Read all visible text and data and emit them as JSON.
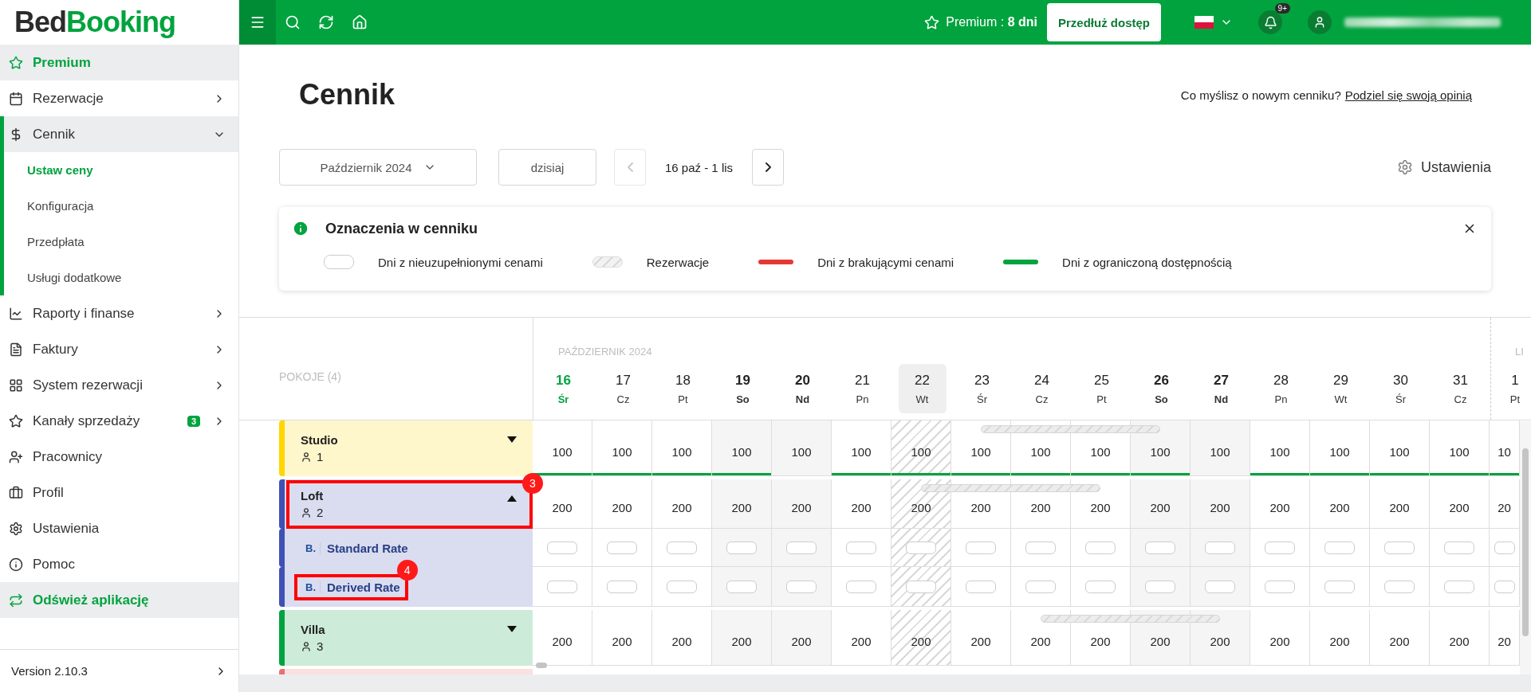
{
  "brand": {
    "part_1": "Bed",
    "part_2": "Booking"
  },
  "sidebar": {
    "items": [
      {
        "label": "Premium",
        "kind": "accent"
      },
      {
        "label": "Rezerwacje",
        "kind": "link",
        "expanded": false
      },
      {
        "label": "Cennik",
        "kind": "link",
        "expanded": true,
        "children": [
          {
            "label": "Ustaw ceny",
            "selected": true
          },
          {
            "label": "Konfiguracja",
            "selected": false
          },
          {
            "label": "Przedpłata",
            "selected": false
          },
          {
            "label": "Usługi dodatkowe",
            "selected": false
          }
        ]
      },
      {
        "label": "Raporty i finanse",
        "kind": "link",
        "expanded": false
      },
      {
        "label": "Faktury",
        "kind": "link",
        "expanded": false
      },
      {
        "label": "System rezerwacji",
        "kind": "link",
        "expanded": false
      },
      {
        "label": "Kanały sprzedaży",
        "kind": "link",
        "expanded": false,
        "badge": "3"
      },
      {
        "label": "Pracownicy",
        "kind": "link"
      },
      {
        "label": "Profil",
        "kind": "link"
      },
      {
        "label": "Ustawienia",
        "kind": "link"
      },
      {
        "label": "Pomoc",
        "kind": "link"
      },
      {
        "label": "Odśwież aplikację",
        "kind": "accent"
      }
    ],
    "version": "Version 2.10.3"
  },
  "topbar": {
    "premium": "Premium : **8 dni**",
    "extend_button": "Przedłuż dostęp",
    "notifications_badge": "9+"
  },
  "page": {
    "title": "Cennik",
    "feedback_question": "Co myślisz o nowym cenniku?",
    "feedback_link": "Podziel się swoją opinią"
  },
  "toolbar": {
    "month_select": "Październik 2024",
    "today_button": "dzisiaj",
    "range": "16 paź - 1 lis",
    "prev_disabled": true,
    "next_disabled": false,
    "settings": "Ustawienia"
  },
  "legend": {
    "title": "Oznaczenia w cenniku",
    "items": [
      {
        "kind": "empty",
        "label": "Dni z nieuzupełnionymi cenami"
      },
      {
        "kind": "hatched",
        "label": "Rezerwacje"
      },
      {
        "kind": "missing",
        "label": "Dni z brakującymi cenami"
      },
      {
        "kind": "limited",
        "label": "Dni z ograniczoną dostępnością"
      }
    ]
  },
  "grid": {
    "rooms_header": "POKOJE (4)",
    "months": [
      {
        "label": "PAŹDZIERNIK 2024",
        "days": [
          {
            "day": "16",
            "weekday": "Śr",
            "today": true,
            "weekend": false,
            "highlighted": false,
            "hatched": false
          },
          {
            "day": "17",
            "weekday": "Cz",
            "today": false,
            "weekend": false,
            "highlighted": false,
            "hatched": false
          },
          {
            "day": "18",
            "weekday": "Pt",
            "today": false,
            "weekend": false,
            "highlighted": false,
            "hatched": false
          },
          {
            "day": "19",
            "weekday": "So",
            "today": false,
            "weekend": true,
            "highlighted": false,
            "hatched": false
          },
          {
            "day": "20",
            "weekday": "Nd",
            "today": false,
            "weekend": true,
            "highlighted": false,
            "hatched": false
          },
          {
            "day": "21",
            "weekday": "Pn",
            "today": false,
            "weekend": false,
            "highlighted": false,
            "hatched": false
          },
          {
            "day": "22",
            "weekday": "Wt",
            "today": false,
            "weekend": false,
            "highlighted": true,
            "hatched": true
          },
          {
            "day": "23",
            "weekday": "Śr",
            "today": false,
            "weekend": false,
            "highlighted": false,
            "hatched": false
          },
          {
            "day": "24",
            "weekday": "Cz",
            "today": false,
            "weekend": false,
            "highlighted": false,
            "hatched": false
          },
          {
            "day": "25",
            "weekday": "Pt",
            "today": false,
            "weekend": false,
            "highlighted": false,
            "hatched": false
          },
          {
            "day": "26",
            "weekday": "So",
            "today": false,
            "weekend": true,
            "highlighted": false,
            "hatched": false
          },
          {
            "day": "27",
            "weekday": "Nd",
            "today": false,
            "weekend": true,
            "highlighted": false,
            "hatched": false
          },
          {
            "day": "28",
            "weekday": "Pn",
            "today": false,
            "weekend": false,
            "highlighted": false,
            "hatched": false
          },
          {
            "day": "29",
            "weekday": "Wt",
            "today": false,
            "weekend": false,
            "highlighted": false,
            "hatched": false
          },
          {
            "day": "30",
            "weekday": "Śr",
            "today": false,
            "weekend": false,
            "highlighted": false,
            "hatched": false
          },
          {
            "day": "31",
            "weekday": "Cz",
            "today": false,
            "weekend": false,
            "highlighted": false,
            "hatched": false
          }
        ]
      },
      {
        "label": "LI",
        "days": [
          {
            "day": "1",
            "weekday": "Pt",
            "today": false,
            "weekend": false,
            "highlighted": false,
            "hatched": false
          }
        ]
      }
    ],
    "rooms": [
      {
        "name": "Studio",
        "guests": "1",
        "color": "#ffd600",
        "expanded": false,
        "cells": [
          {
            "value": "100",
            "limited": true,
            "booked": false
          },
          {
            "value": "100",
            "limited": true,
            "booked": false
          },
          {
            "value": "100",
            "limited": true,
            "booked": false
          },
          {
            "value": "100",
            "limited": true,
            "booked": false
          },
          {
            "value": "100",
            "limited": false,
            "booked": false
          },
          {
            "value": "100",
            "limited": true,
            "booked": false
          },
          {
            "value": "100",
            "limited": true,
            "booked": false
          },
          {
            "value": "100",
            "limited": true,
            "booked": true
          },
          {
            "value": "100",
            "limited": true,
            "booked": true
          },
          {
            "value": "100",
            "limited": true,
            "booked": true
          },
          {
            "value": "100",
            "limited": true,
            "booked": true
          },
          {
            "value": "100",
            "limited": false,
            "booked": false
          },
          {
            "value": "100",
            "limited": true,
            "booked": false
          },
          {
            "value": "100",
            "limited": true,
            "booked": false
          },
          {
            "value": "100",
            "limited": true,
            "booked": false
          },
          {
            "value": "100",
            "limited": true,
            "booked": false
          },
          {
            "value": "10",
            "limited": true,
            "booked": false
          }
        ]
      },
      {
        "name": "Loft",
        "guests": "2",
        "color": "#3f51b5",
        "expanded": true,
        "callout": "3",
        "cells": [
          {
            "value": "200",
            "limited": false,
            "booked": false
          },
          {
            "value": "200",
            "limited": false,
            "booked": false
          },
          {
            "value": "200",
            "limited": false,
            "booked": false
          },
          {
            "value": "200",
            "limited": false,
            "booked": false
          },
          {
            "value": "200",
            "limited": false,
            "booked": false
          },
          {
            "value": "200",
            "limited": false,
            "booked": false
          },
          {
            "value": "200",
            "limited": false,
            "booked": true
          },
          {
            "value": "200",
            "limited": false,
            "booked": true
          },
          {
            "value": "200",
            "limited": false,
            "booked": true
          },
          {
            "value": "200",
            "limited": false,
            "booked": true
          },
          {
            "value": "200",
            "limited": false,
            "booked": false
          },
          {
            "value": "200",
            "limited": false,
            "booked": false
          },
          {
            "value": "200",
            "limited": false,
            "booked": false
          },
          {
            "value": "200",
            "limited": false,
            "booked": false
          },
          {
            "value": "200",
            "limited": false,
            "booked": false
          },
          {
            "value": "200",
            "limited": false,
            "booked": false
          },
          {
            "value": "20",
            "limited": false,
            "booked": false
          }
        ],
        "rates": [
          {
            "channel_mark": "B.",
            "name": "Standard Rate"
          },
          {
            "channel_mark": "B.",
            "name": "Derived Rate",
            "callout": "4"
          }
        ]
      },
      {
        "name": "Villa",
        "guests": "3",
        "color": "#00a33e",
        "expanded": false,
        "cells": [
          {
            "value": "200",
            "limited": false,
            "booked": false
          },
          {
            "value": "200",
            "limited": false,
            "booked": false
          },
          {
            "value": "200",
            "limited": false,
            "booked": false
          },
          {
            "value": "200",
            "limited": false,
            "booked": false
          },
          {
            "value": "200",
            "limited": false,
            "booked": false
          },
          {
            "value": "200",
            "limited": false,
            "booked": false
          },
          {
            "value": "200",
            "limited": false,
            "booked": false
          },
          {
            "value": "200",
            "limited": false,
            "booked": false
          },
          {
            "value": "200",
            "limited": false,
            "booked": true
          },
          {
            "value": "200",
            "limited": false,
            "booked": true
          },
          {
            "value": "200",
            "limited": false,
            "booked": true
          },
          {
            "value": "200",
            "limited": false,
            "booked": true
          },
          {
            "value": "200",
            "limited": false,
            "booked": false
          },
          {
            "value": "200",
            "limited": false,
            "booked": false
          },
          {
            "value": "200",
            "limited": false,
            "booked": false
          },
          {
            "value": "200",
            "limited": false,
            "booked": false
          },
          {
            "value": "20",
            "limited": false,
            "booked": false
          }
        ]
      },
      {
        "color": "#e57373"
      }
    ]
  }
}
